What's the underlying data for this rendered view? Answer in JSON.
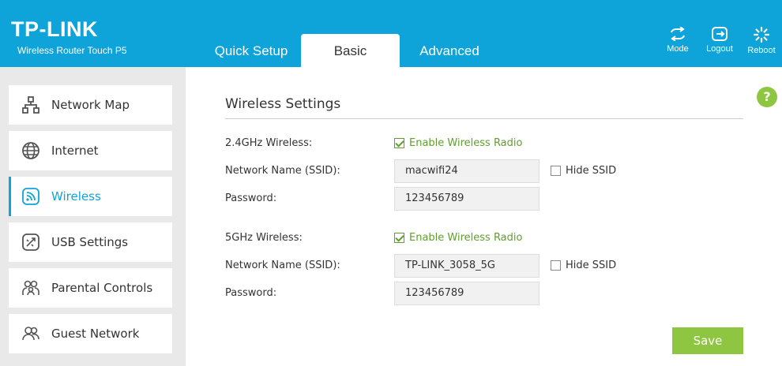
{
  "header": {
    "brand": "TP-LINK",
    "model": "Wireless Router Touch P5",
    "tabs": [
      "Quick Setup",
      "Basic",
      "Advanced"
    ],
    "active_tab": "Basic",
    "buttons": {
      "mode": "Mode",
      "logout": "Logout",
      "reboot": "Reboot"
    }
  },
  "sidebar": {
    "items": [
      {
        "label": "Network Map",
        "icon": "network-map-icon"
      },
      {
        "label": "Internet",
        "icon": "globe-icon"
      },
      {
        "label": "Wireless",
        "icon": "wireless-icon"
      },
      {
        "label": "USB Settings",
        "icon": "usb-icon"
      },
      {
        "label": "Parental Controls",
        "icon": "parental-icon"
      },
      {
        "label": "Guest Network",
        "icon": "guest-icon"
      }
    ],
    "active": "Wireless"
  },
  "help": "?",
  "main": {
    "title": "Wireless Settings",
    "band24": {
      "label": "2.4GHz Wireless:",
      "enable_label": "Enable Wireless Radio",
      "enabled": true,
      "ssid_label": "Network Name (SSID):",
      "ssid": "macwifi24",
      "hide_label": "Hide SSID",
      "hidden": false,
      "password_label": "Password:",
      "password": "123456789"
    },
    "band5": {
      "label": "5GHz Wireless:",
      "enable_label": "Enable Wireless Radio",
      "enabled": true,
      "ssid_label": "Network Name (SSID):",
      "ssid": "TP-LINK_3058_5G",
      "hide_label": "Hide SSID",
      "hidden": false,
      "password_label": "Password:",
      "password": "123456789"
    },
    "save_label": "Save"
  },
  "colors": {
    "accent": "#0fa4d9",
    "green": "#8ec641",
    "check_green": "#5fa02c"
  }
}
